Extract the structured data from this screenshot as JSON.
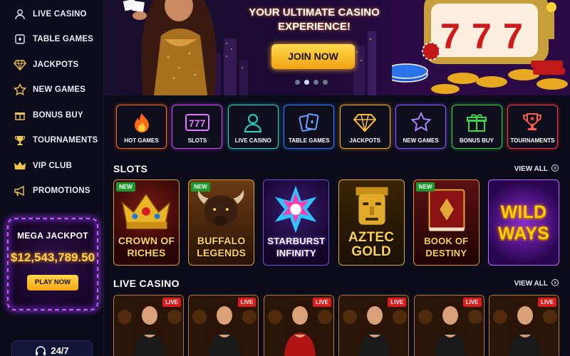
{
  "sidebar": {
    "items": [
      {
        "label": "LIVE CASINO",
        "icon": "user-icon"
      },
      {
        "label": "TABLE GAMES",
        "icon": "cards-icon"
      },
      {
        "label": "JACKPOTS",
        "icon": "diamond-icon"
      },
      {
        "label": "NEW GAMES",
        "icon": "star-icon"
      },
      {
        "label": "BONUS BUY",
        "icon": "gift-icon"
      },
      {
        "label": "TOURNAMENTS",
        "icon": "trophy-icon"
      },
      {
        "label": "VIP CLUB",
        "icon": "crown-icon"
      },
      {
        "label": "PROMOTIONS",
        "icon": "megaphone-icon"
      }
    ],
    "jackpot": {
      "title": "MEGA JACKPOT",
      "amount": "$12,543,789.50",
      "button": "PLAY NOW"
    },
    "support": {
      "label": "24/7",
      "icon": "headset-icon"
    }
  },
  "hero": {
    "title": "YOUR ULTIMATE CASINO EXPERIENCE!",
    "button": "JOIN NOW",
    "slides": 4,
    "active_slide": 2,
    "slot_symbol": "777"
  },
  "categories": [
    {
      "label": "HOT GAMES",
      "icon": "flame-icon",
      "color": "#ff6a1a"
    },
    {
      "label": "SLOTS",
      "icon": "slots-777-icon",
      "color": "#d24bff"
    },
    {
      "label": "LIVE CASINO",
      "icon": "dealer-icon",
      "color": "#27d6c4"
    },
    {
      "label": "TABLE GAMES",
      "icon": "cards-icon",
      "color": "#3a7bff"
    },
    {
      "label": "JACKPOTS",
      "icon": "diamond-icon",
      "color": "#ffb020"
    },
    {
      "label": "NEW GAMES",
      "icon": "star-icon",
      "color": "#8a5cff"
    },
    {
      "label": "BONUS BUY",
      "icon": "gift-icon",
      "color": "#3bd44a"
    },
    {
      "label": "TOURNAMENTS",
      "icon": "trophy-icon",
      "color": "#ff3b3b"
    }
  ],
  "slots": {
    "title": "SLOTS",
    "view_all": "VIEW ALL",
    "games": [
      {
        "name": "CROWN OF RICHES",
        "new": "NEW"
      },
      {
        "name": "BUFFALO LEGENDS",
        "new": "NEW"
      },
      {
        "name": "STARBURST INFINITY",
        "new": ""
      },
      {
        "name": "AZTEC GOLD",
        "new": ""
      },
      {
        "name": "BOOK OF DESTINY",
        "new": "NEW"
      },
      {
        "name": "WILD WAYS",
        "new": ""
      }
    ]
  },
  "live": {
    "title": "LIVE CASINO",
    "view_all": "VIEW ALL",
    "badge": "LIVE",
    "tables": 6
  }
}
